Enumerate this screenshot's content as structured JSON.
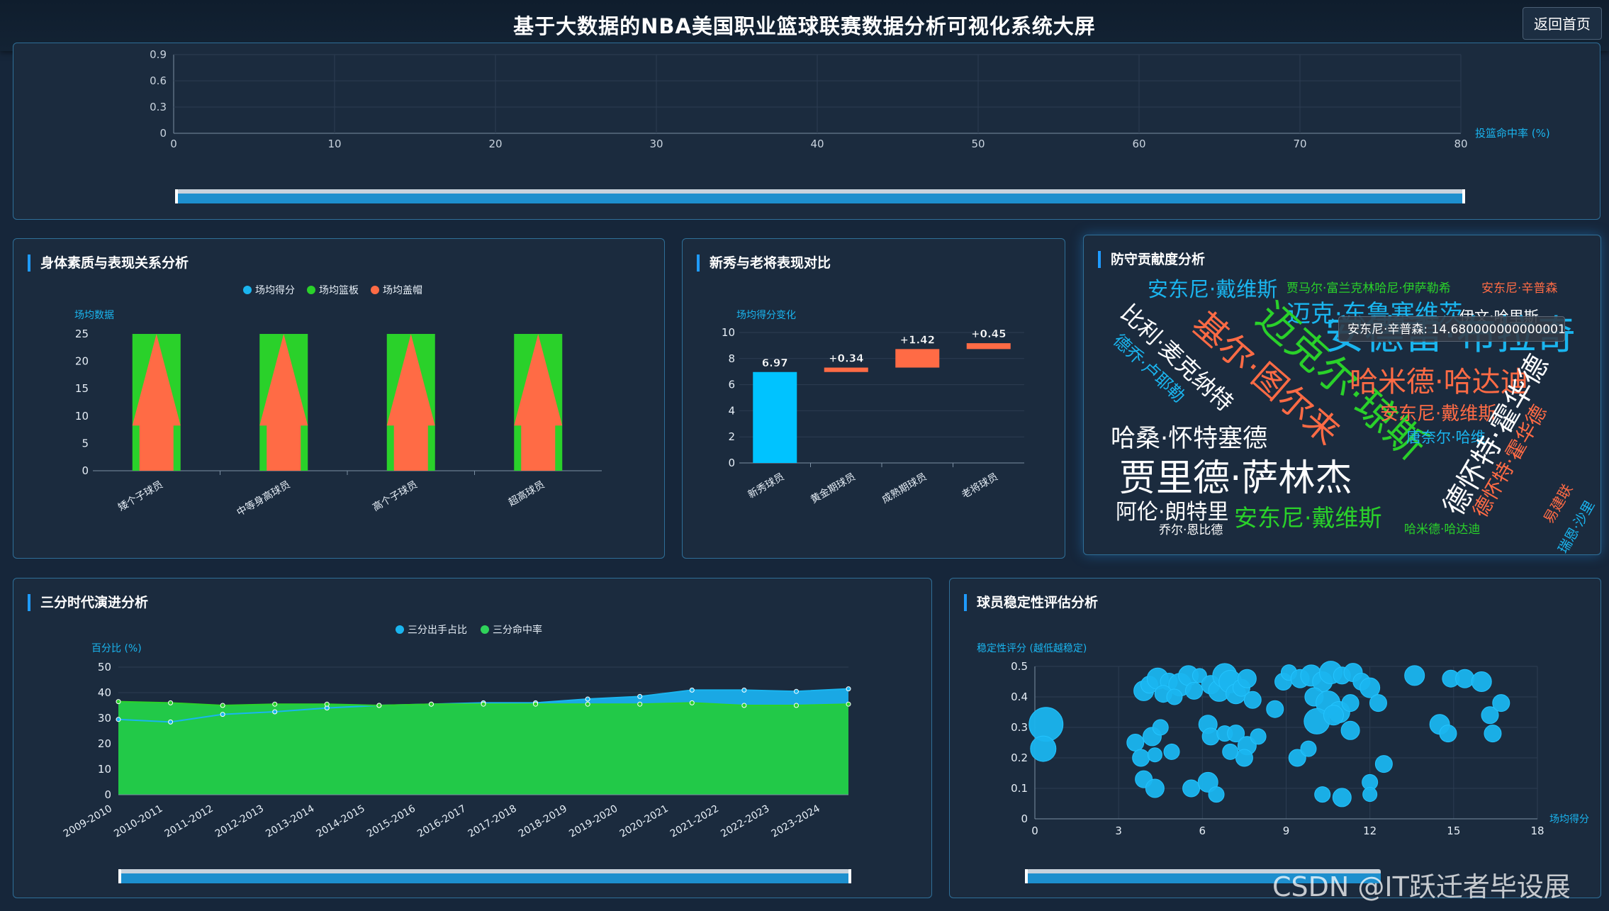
{
  "header": {
    "title": "基于大数据的NBA美国职业篮球联赛数据分析可视化系统大屏",
    "home_button": "返回首页"
  },
  "colors": {
    "blue": "#1ab5ef",
    "green": "#2ad12a",
    "orange": "#ff6b45",
    "panel_border": "#2f6f98"
  },
  "top_chart": {
    "type": "scatter",
    "y_ticks": [
      "0.9",
      "0.6",
      "0.3",
      "0"
    ],
    "x_ticks": [
      "0",
      "10",
      "20",
      "30",
      "40",
      "50",
      "60",
      "70",
      "80"
    ],
    "xlabel": "投篮命中率 (%)",
    "xlim": [
      0,
      80
    ],
    "ylim": [
      0,
      0.9
    ],
    "grid": true
  },
  "panels": {
    "physical": {
      "title": "身体素质与表现关系分析"
    },
    "rookie": {
      "title": "新秀与老将表现对比"
    },
    "defense": {
      "title": "防守贡献度分析"
    },
    "three": {
      "title": "三分时代演进分析"
    },
    "stability": {
      "title": "球员稳定性评估分析"
    }
  },
  "chart_data": [
    {
      "id": "physical",
      "type": "bar",
      "title": "",
      "ylabel": "场均数据",
      "categories": [
        "矮个子球员",
        "中等身高球员",
        "高个子球员",
        "超高球员"
      ],
      "series": [
        {
          "name": "场均得分",
          "values": [
            25,
            25,
            25,
            25
          ]
        },
        {
          "name": "场均篮板",
          "values": [
            25,
            25,
            25,
            25
          ]
        },
        {
          "name": "场均盖帽",
          "values": [
            25,
            25,
            25,
            25
          ]
        }
      ],
      "y_ticks": [
        "25",
        "20",
        "15",
        "10",
        "5",
        "0"
      ],
      "ylim": [
        0,
        25
      ],
      "legend": "top-center"
    },
    {
      "id": "rookie",
      "type": "bar",
      "title": "",
      "ylabel": "场均得分变化",
      "categories": [
        "新秀球员",
        "黄金期球员",
        "成熟期球员",
        "老将球员"
      ],
      "values": [
        6.97,
        0.34,
        1.42,
        0.45
      ],
      "value_labels": [
        "6.97",
        "+0.34",
        "+1.42",
        "+0.45"
      ],
      "y_ticks": [
        "10",
        "8",
        "6",
        "4",
        "2",
        "0"
      ],
      "ylim": [
        0,
        10
      ]
    },
    {
      "id": "three",
      "type": "area",
      "title": "",
      "ylabel": "百分比 (%)",
      "categories": [
        "2009-2010",
        "2010-2011",
        "2011-2012",
        "2012-2013",
        "2013-2014",
        "2014-2015",
        "2015-2016",
        "2016-2017",
        "2017-2018",
        "2018-2019",
        "2019-2020",
        "2020-2021",
        "2021-2022",
        "2022-2023",
        "2023-2024"
      ],
      "series": [
        {
          "name": "三分出手占比",
          "values": [
            29.5,
            28.5,
            31.5,
            32.5,
            34,
            35,
            35.5,
            36,
            36,
            37.5,
            38.5,
            41,
            41,
            40.5,
            41.5
          ]
        },
        {
          "name": "三分命中率",
          "values": [
            36.5,
            36,
            35,
            35.5,
            35.5,
            35,
            35.5,
            35.5,
            35.5,
            35.5,
            35.5,
            36,
            35,
            35,
            35.5
          ]
        }
      ],
      "y_ticks": [
        "50",
        "40",
        "30",
        "20",
        "10",
        "0"
      ],
      "ylim": [
        0,
        50
      ],
      "legend": "top-center"
    },
    {
      "id": "stability",
      "type": "scatter",
      "title": "",
      "ylabel": "稳定性评分 (越低越稳定)",
      "xlabel": "场均得分",
      "x_ticks": [
        "0",
        "3",
        "6",
        "9",
        "12",
        "15",
        "18"
      ],
      "y_ticks": [
        "0.5",
        "0.4",
        "0.3",
        "0.2",
        "0.1",
        "0"
      ],
      "xlim": [
        0,
        18
      ],
      "ylim": [
        0,
        0.5
      ],
      "grid": true,
      "points": [
        [
          0.4,
          0.31,
          24
        ],
        [
          0.3,
          0.23,
          18
        ],
        [
          3.9,
          0.42,
          14
        ],
        [
          4.1,
          0.44,
          12
        ],
        [
          4.4,
          0.46,
          15
        ],
        [
          4.8,
          0.45,
          12
        ],
        [
          5.2,
          0.44,
          16
        ],
        [
          5.5,
          0.47,
          14
        ],
        [
          4.6,
          0.41,
          12
        ],
        [
          5.0,
          0.4,
          11
        ],
        [
          5.7,
          0.42,
          12
        ],
        [
          5.9,
          0.47,
          10
        ],
        [
          6.3,
          0.44,
          13
        ],
        [
          6.6,
          0.42,
          15
        ],
        [
          6.8,
          0.47,
          17
        ],
        [
          7.0,
          0.45,
          16
        ],
        [
          7.2,
          0.41,
          14
        ],
        [
          7.4,
          0.43,
          12
        ],
        [
          7.6,
          0.46,
          13
        ],
        [
          7.8,
          0.39,
          12
        ],
        [
          3.6,
          0.25,
          12
        ],
        [
          4.2,
          0.27,
          13
        ],
        [
          4.5,
          0.3,
          11
        ],
        [
          3.8,
          0.2,
          12
        ],
        [
          4.9,
          0.22,
          11
        ],
        [
          4.3,
          0.21,
          10
        ],
        [
          3.9,
          0.13,
          12
        ],
        [
          4.3,
          0.1,
          13
        ],
        [
          5.6,
          0.1,
          12
        ],
        [
          6.2,
          0.12,
          14
        ],
        [
          6.5,
          0.08,
          11
        ],
        [
          6.2,
          0.31,
          13
        ],
        [
          6.3,
          0.27,
          12
        ],
        [
          6.8,
          0.28,
          11
        ],
        [
          7.2,
          0.28,
          12
        ],
        [
          7.6,
          0.24,
          13
        ],
        [
          8.0,
          0.27,
          11
        ],
        [
          7.5,
          0.2,
          12
        ],
        [
          7.0,
          0.22,
          11
        ],
        [
          8.6,
          0.36,
          12
        ],
        [
          8.9,
          0.45,
          12
        ],
        [
          9.1,
          0.48,
          11
        ],
        [
          9.5,
          0.46,
          13
        ],
        [
          9.9,
          0.47,
          15
        ],
        [
          10.3,
          0.45,
          14
        ],
        [
          10.6,
          0.48,
          16
        ],
        [
          11.0,
          0.47,
          12
        ],
        [
          11.4,
          0.48,
          13
        ],
        [
          11.7,
          0.45,
          12
        ],
        [
          12.0,
          0.43,
          14
        ],
        [
          10.0,
          0.4,
          13
        ],
        [
          10.5,
          0.38,
          17
        ],
        [
          10.9,
          0.35,
          15
        ],
        [
          11.3,
          0.38,
          12
        ],
        [
          10.1,
          0.32,
          18
        ],
        [
          10.7,
          0.34,
          14
        ],
        [
          11.3,
          0.29,
          13
        ],
        [
          9.4,
          0.2,
          12
        ],
        [
          9.8,
          0.23,
          11
        ],
        [
          12.5,
          0.18,
          12
        ],
        [
          12.0,
          0.12,
          11
        ],
        [
          12.0,
          0.08,
          10
        ],
        [
          11.0,
          0.07,
          13
        ],
        [
          10.3,
          0.08,
          11
        ],
        [
          13.6,
          0.47,
          14
        ],
        [
          14.9,
          0.46,
          12
        ],
        [
          15.4,
          0.46,
          13
        ],
        [
          16.0,
          0.45,
          14
        ],
        [
          16.3,
          0.34,
          12
        ],
        [
          16.7,
          0.38,
          12
        ],
        [
          16.4,
          0.28,
          12
        ],
        [
          14.5,
          0.31,
          14
        ],
        [
          14.8,
          0.28,
          12
        ],
        [
          12.3,
          0.38,
          12
        ]
      ]
    }
  ],
  "wordcloud": {
    "words": [
      {
        "text": "安东尼·戴维斯",
        "color": "#1ab5ef"
      },
      {
        "text": "贾马尔·富兰克林哈尼·伊萨勒希",
        "color": "#2ad12a"
      },
      {
        "text": "安东尼·辛普森",
        "color": "#ff6b45"
      },
      {
        "text": "迈克·东鲁塞维茨",
        "color": "#1ab5ef"
      },
      {
        "text": "伊文·哈里斯",
        "color": "#ffffff"
      },
      {
        "text": "比利·麦克纳特",
        "color": "#ffffff"
      },
      {
        "text": "基尔·图尔来",
        "color": "#ff6b45"
      },
      {
        "text": "迈克尔·琼斯",
        "color": "#2ad12a"
      },
      {
        "text": "安德雷·布拉奇",
        "color": "#1ab5ef"
      },
      {
        "text": "德乔·卢耶勒",
        "color": "#1ab5ef"
      },
      {
        "text": "哈米德·哈达迪",
        "color": "#ff6b45"
      },
      {
        "text": "安东尼·戴维斯",
        "color": "#ff6b45"
      },
      {
        "text": "唐奈尔·哈维",
        "color": "#1ab5ef"
      },
      {
        "text": "德怀特·霍华德",
        "color": "#ffffff"
      },
      {
        "text": "德怀特·霍华德",
        "color": "#ff6b45"
      },
      {
        "text": "哈桑·怀特塞德",
        "color": "#ffffff"
      },
      {
        "text": "贾里德·萨林杰",
        "color": "#ffffff"
      },
      {
        "text": "易建联",
        "color": "#ff6b45"
      },
      {
        "text": "阿伦·朗特里",
        "color": "#ffffff"
      },
      {
        "text": "安东尼·戴维斯",
        "color": "#2ad12a"
      },
      {
        "text": "乔尔·恩比德",
        "color": "#ffffff"
      },
      {
        "text": "哈米德·哈达迪",
        "color": "#2ad12a"
      },
      {
        "text": "瑞恩·沙里",
        "color": "#1ab5ef"
      }
    ],
    "tooltip": "安东尼·辛普森: 14.680000000000001"
  },
  "watermark": "CSDN @IT跃迁者毕设展"
}
